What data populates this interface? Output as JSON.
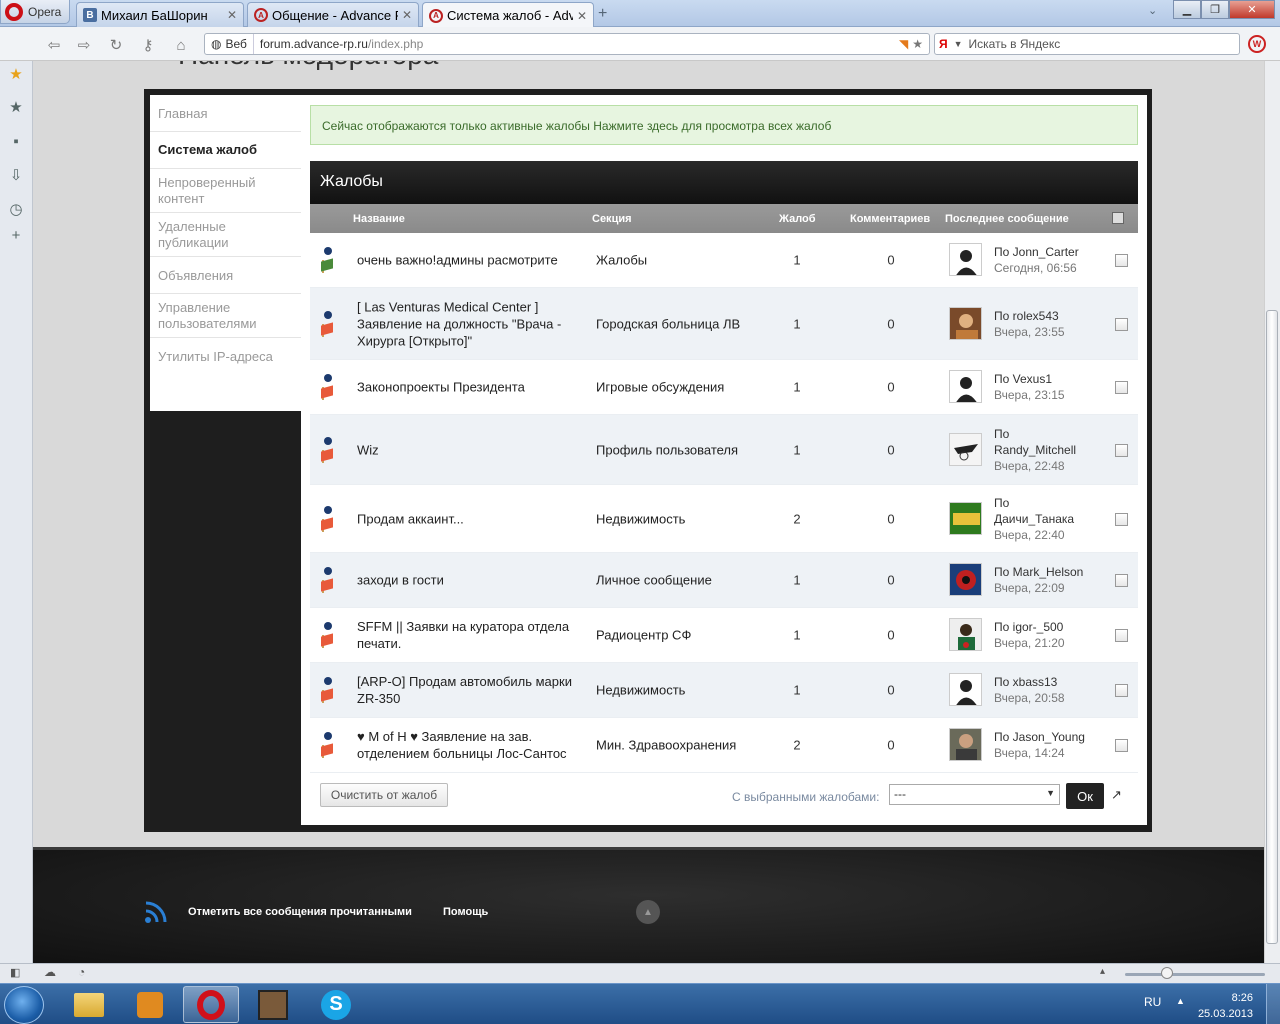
{
  "browser": {
    "menu_label": "Opera",
    "tabs": [
      {
        "label": "Михаил БаШорин",
        "icon": "vk-icon"
      },
      {
        "label": "Общение - Advance R...",
        "icon": "advance-rp-icon"
      },
      {
        "label": "Система жалоб - Adv...",
        "icon": "advance-rp-icon"
      }
    ],
    "address": {
      "scheme_label": "Веб",
      "url_host": "forum.advance-rp.ru",
      "url_path": "/index.php"
    },
    "search_placeholder": "Искать в Яндекс"
  },
  "page": {
    "heading": "Панель модератора",
    "menu": [
      {
        "label": "Главная"
      },
      {
        "label": "Система жалоб"
      },
      {
        "label": "Непроверенный контент"
      },
      {
        "label": "Удаленные публикации"
      },
      {
        "label": "Объявления"
      },
      {
        "label": "Управление пользователями"
      },
      {
        "label": "Утилиты IP-адреса"
      }
    ],
    "notice": "Сейчас отображаются только активные жалобы Нажмите здесь для просмотра всех жалоб",
    "table_title": "Жалобы",
    "columns": {
      "name": "Название",
      "section": "Секция",
      "reports": "Жалоб",
      "comments": "Комментариев",
      "last": "Последнее сообщение"
    },
    "rows": [
      {
        "title": "очень важно!админы расмотрите",
        "section": "Жалобы",
        "reports": "1",
        "comments": "0",
        "by": "По",
        "user": "Jonn_Carter",
        "time": "Сегодня, 06:56"
      },
      {
        "title": "[ Las Venturas Medical Center ] Заявление на должность \"Врача - Хирурга [Открыто]\"",
        "section": "Городская больница ЛВ",
        "reports": "1",
        "comments": "0",
        "by": "По",
        "user": "rolex543",
        "time": "Вчера, 23:55"
      },
      {
        "title": "Законопроекты Президента",
        "section": "Игровые обсуждения",
        "reports": "1",
        "comments": "0",
        "by": "По",
        "user": "Vexus1",
        "time": "Вчера, 23:15"
      },
      {
        "title": "Wiz",
        "section": "Профиль пользователя",
        "reports": "1",
        "comments": "0",
        "by": "По",
        "user": "Randy_Mitchell",
        "time": "Вчера, 22:48"
      },
      {
        "title": "Продам аккаинт...",
        "section": "Недвижимость",
        "reports": "2",
        "comments": "0",
        "by": "По",
        "user": "Даичи_Танака",
        "time": "Вчера, 22:40"
      },
      {
        "title": "заходи в гости",
        "section": "Личное сообщение",
        "reports": "1",
        "comments": "0",
        "by": "По",
        "user": "Mark_Helson",
        "time": "Вчера, 22:09"
      },
      {
        "title": "SFFM || Заявки на куратора отдела печати.",
        "section": "Радиоцентр СФ",
        "reports": "1",
        "comments": "0",
        "by": "По",
        "user": "igor-_500",
        "time": "Вчера, 21:20"
      },
      {
        "title": "[ARP-O] Продам автомобиль марки ZR-350",
        "section": "Недвижимость",
        "reports": "1",
        "comments": "0",
        "by": "По",
        "user": "xbass13",
        "time": "Вчера, 20:58"
      },
      {
        "title": "♥ M of H ♥ Заявление на зав. отделением больницы Лос-Сантос",
        "section": "Мин. Здравоохранения",
        "reports": "2",
        "comments": "0",
        "by": "По",
        "user": "Jason_Young",
        "time": "Вчера, 14:24"
      }
    ],
    "clear_button": "Очистить от жалоб",
    "with_selected": "С выбранными жалобами:",
    "action_select": "---",
    "ok_button": "Ок",
    "footer": {
      "mark_read": "Отметить все сообщения прочитанными",
      "help": "Помощь"
    }
  },
  "taskbar": {
    "lang": "RU",
    "time": "8:26",
    "date": "25.03.2013"
  },
  "colors": {
    "panel": "#1e1e1e",
    "notice_bg": "#e7f5e0",
    "accent_red": "#cc0f16"
  }
}
